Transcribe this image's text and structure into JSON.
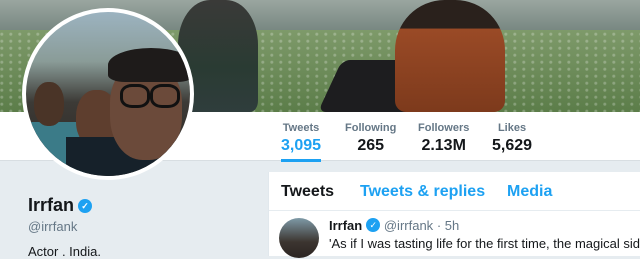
{
  "profile": {
    "name": "Irrfan",
    "handle": "@irrfank",
    "bio": "Actor . India."
  },
  "stats": [
    {
      "label": "Tweets",
      "value": "3,095"
    },
    {
      "label": "Following",
      "value": "265"
    },
    {
      "label": "Followers",
      "value": "2.13M"
    },
    {
      "label": "Likes",
      "value": "5,629"
    }
  ],
  "tabs": [
    "Tweets",
    "Tweets & replies",
    "Media"
  ],
  "tweet": {
    "author": "Irrfan",
    "handle": "@irrfank",
    "separator": "·",
    "time": "5h",
    "text": "'As if I was tasting life for the first time, the magical side of i"
  },
  "colors": {
    "accent": "#1da1f2",
    "text": "#14171a",
    "muted": "#657786",
    "background": "#e6ecf0"
  },
  "icons": {
    "verified": "verified-badge-icon"
  }
}
